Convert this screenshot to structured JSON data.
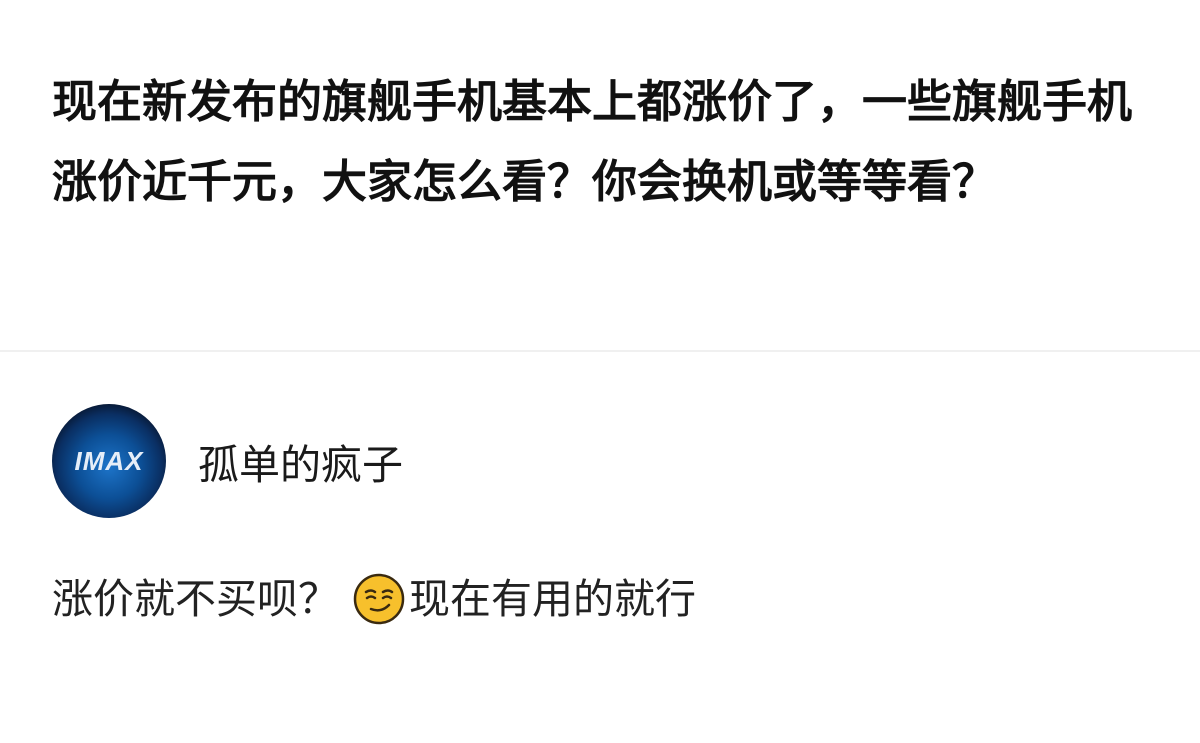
{
  "question": {
    "title": "现在新发布的旗舰手机基本上都涨价了，一些旗舰手机涨价近千元，大家怎么看？你会换机或等等看？"
  },
  "answer": {
    "author": {
      "name": "孤单的疯子",
      "avatar_text": "IMAX"
    },
    "text_before": "涨价就不买呗？",
    "emoji": "smirk-face-icon",
    "text_after": "现在有用的就行"
  },
  "colors": {
    "emoji_yellow": "#f7c02c",
    "avatar_blue": "#1d74c9"
  }
}
